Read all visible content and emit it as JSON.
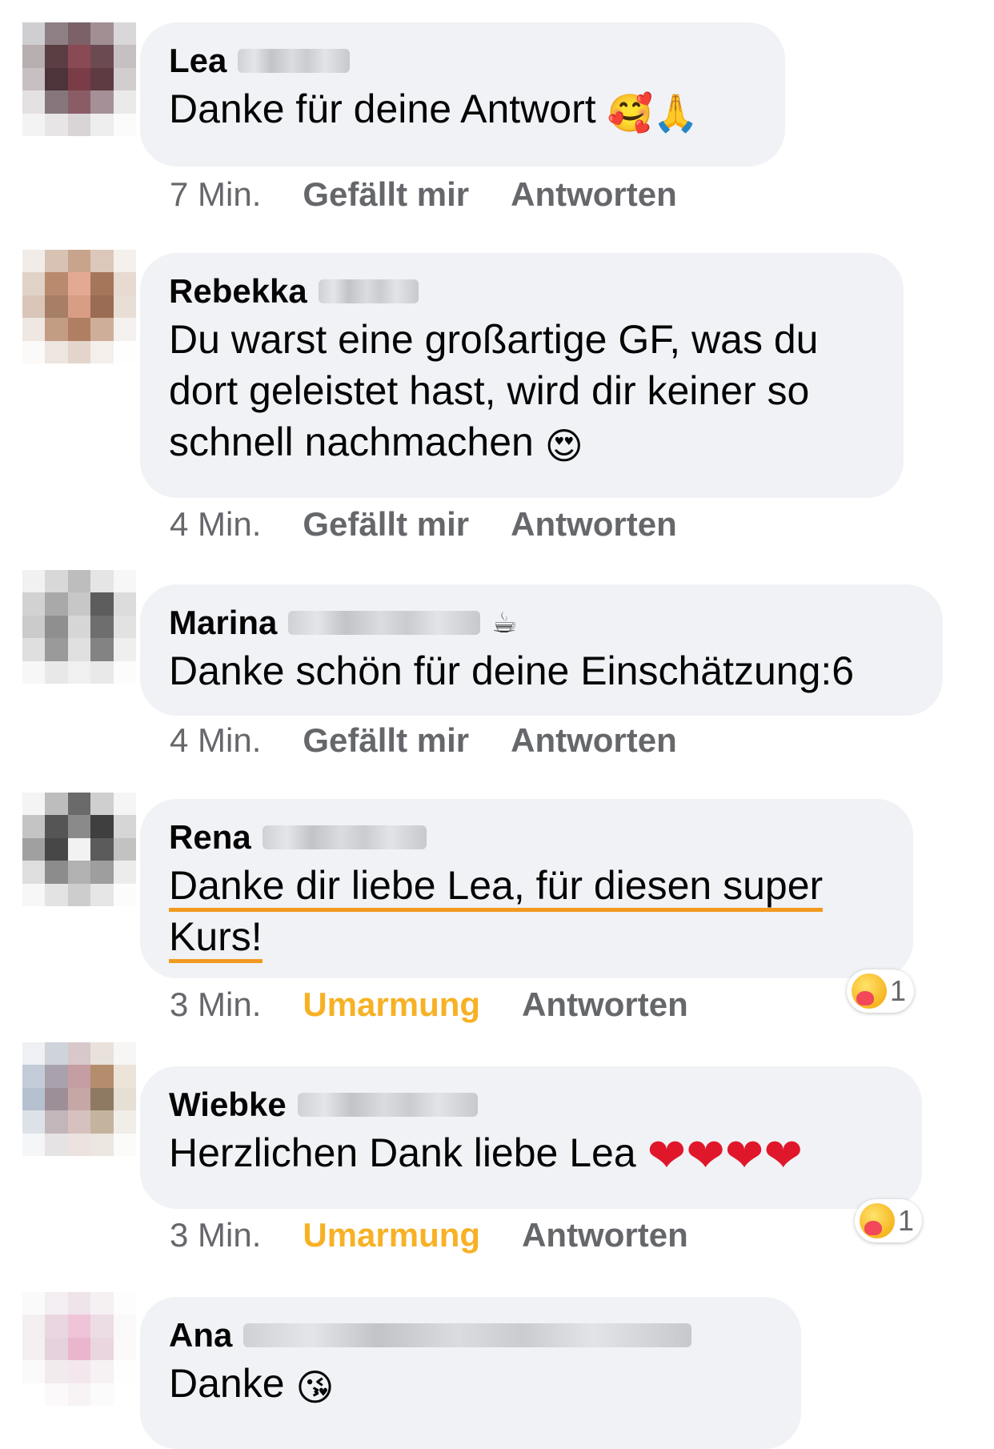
{
  "comments": [
    {
      "author": "Lea",
      "text": "Danke für deine Antwort",
      "emojis": [
        "🥰",
        "🙏"
      ],
      "time": "7 Min.",
      "like_label": "Gefällt mir",
      "reply_label": "Antworten"
    },
    {
      "author": "Rebekka",
      "text": "Du warst eine großartige GF, was du dort geleistet hast, wird dir keiner so schnell nachmachen",
      "emojis": [
        "😍"
      ],
      "time": "4 Min.",
      "like_label": "Gefällt mir",
      "reply_label": "Antworten"
    },
    {
      "author": "Marina",
      "author_icon": "☕",
      "text": "Danke schön für deine Einschätzung:6",
      "time": "4 Min.",
      "like_label": "Gefällt mir",
      "reply_label": "Antworten"
    },
    {
      "author": "Rena",
      "text_line1": "Danke dir liebe Lea,  für diesen super",
      "text_line2": "Kurs!",
      "time": "3 Min.",
      "like_label": "Umarmung",
      "reply_label": "Antworten",
      "reaction_count": "1",
      "reaction_icon": "care-reaction-icon"
    },
    {
      "author": "Wiebke",
      "text": "Herzlichen Dank liebe Lea",
      "emojis": [
        "❤",
        "❤",
        "❤",
        "❤"
      ],
      "time": "3 Min.",
      "like_label": "Umarmung",
      "reply_label": "Antworten",
      "reaction_count": "1",
      "reaction_icon": "care-reaction-icon"
    },
    {
      "author": "Ana",
      "text": "Danke",
      "emojis": [
        "😘"
      ],
      "time": "",
      "like_label": "",
      "reply_label": ""
    }
  ],
  "colors": {
    "bubble": "#f0f2f5",
    "meta_gray": "#65676b",
    "hug_orange": "#f7b125",
    "underline": "#f19a1f"
  }
}
